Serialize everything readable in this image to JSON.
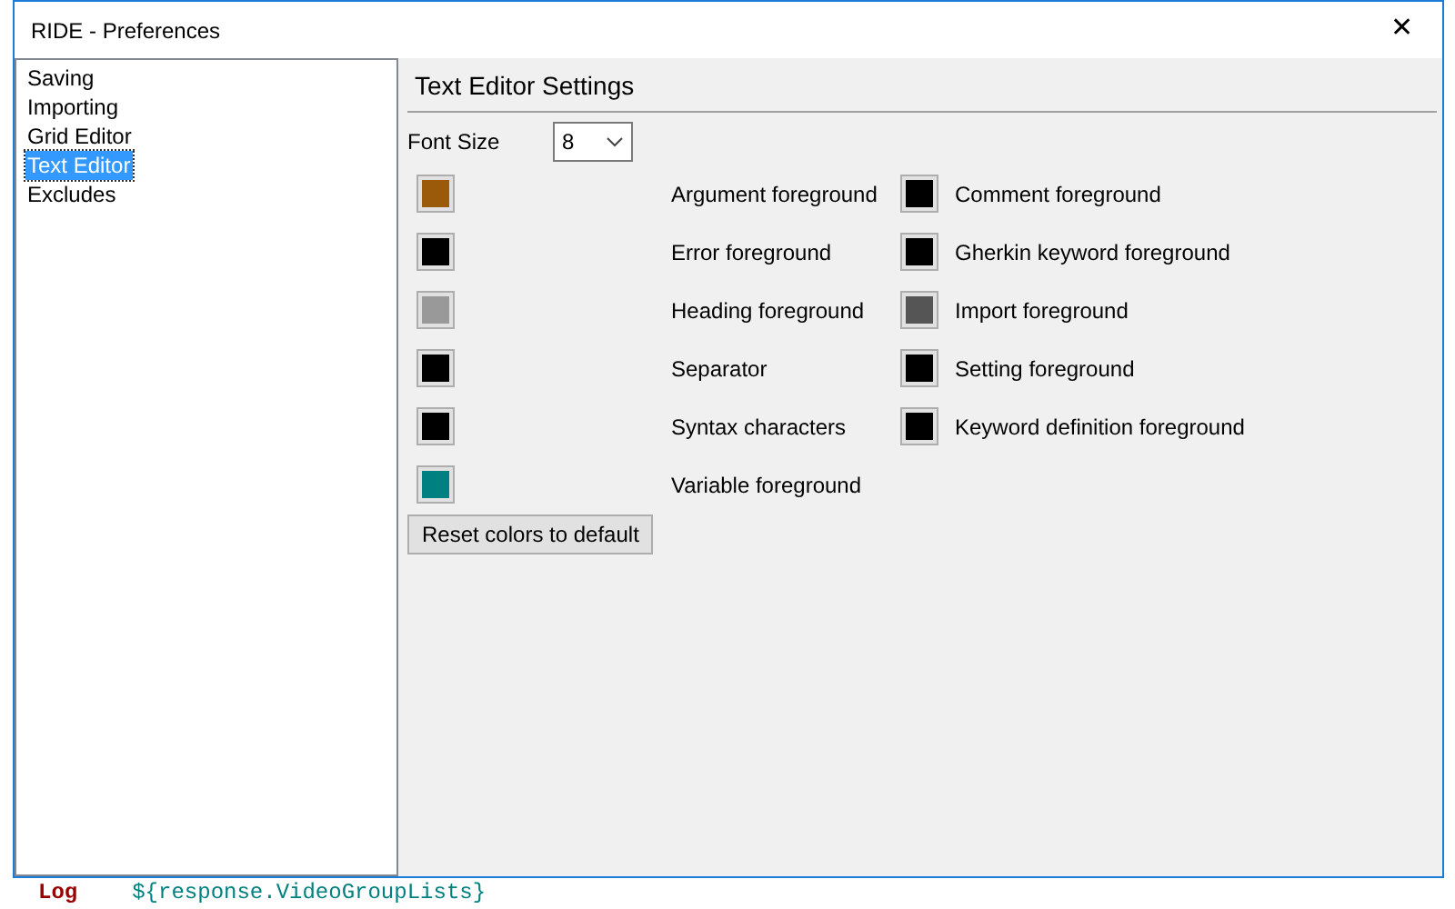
{
  "window": {
    "title": "RIDE - Preferences",
    "close": "✕"
  },
  "sidebar": {
    "items": [
      {
        "label": "Saving",
        "selected": false
      },
      {
        "label": "Importing",
        "selected": false
      },
      {
        "label": "Grid Editor",
        "selected": false
      },
      {
        "label": "Text Editor",
        "selected": true
      },
      {
        "label": "Excludes",
        "selected": false
      }
    ]
  },
  "panel": {
    "heading": "Text Editor Settings",
    "font_size": {
      "label": "Font Size",
      "value": "8"
    },
    "color_rows": [
      {
        "left": {
          "label": "Argument foreground",
          "color": "#9b5a0a"
        },
        "right": {
          "label": "Comment foreground",
          "color": "#000000"
        }
      },
      {
        "left": {
          "label": "Error foreground",
          "color": "#000000"
        },
        "right": {
          "label": "Gherkin keyword foreground",
          "color": "#000000"
        }
      },
      {
        "left": {
          "label": "Heading foreground",
          "color": "#999999"
        },
        "right": {
          "label": "Import foreground",
          "color": "#555555"
        }
      },
      {
        "left": {
          "label": "Separator",
          "color": "#000000"
        },
        "right": {
          "label": "Setting foreground",
          "color": "#000000"
        }
      },
      {
        "left": {
          "label": "Syntax characters",
          "color": "#000000"
        },
        "right": {
          "label": "Keyword definition foreground",
          "color": "#000000"
        }
      },
      {
        "left": {
          "label": "Variable foreground",
          "color": "#008080"
        }
      }
    ],
    "reset_button": "Reset colors to default"
  },
  "background_editor": {
    "keyword": "Log",
    "argument": "${response.VideoGroupLists}"
  }
}
